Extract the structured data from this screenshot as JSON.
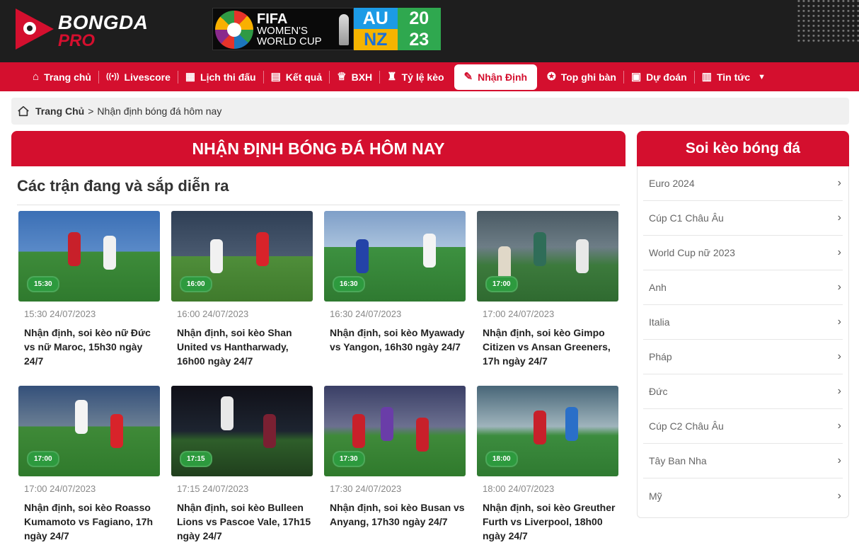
{
  "brand": {
    "name_top": "BONGDA",
    "name_bottom": "PRO"
  },
  "banner": {
    "line1": "FIFA",
    "line2": "WOMEN'S",
    "line3": "WORLD CUP",
    "grid": [
      "AU",
      "20",
      "NZ",
      "23"
    ]
  },
  "nav": {
    "items": [
      {
        "label": "Trang chủ",
        "icon": "home-icon"
      },
      {
        "label": "Livescore",
        "icon": "broadcast-icon"
      },
      {
        "label": "Lịch thi đấu",
        "icon": "calendar-icon"
      },
      {
        "label": "Kết quả",
        "icon": "scoreboard-icon"
      },
      {
        "label": "BXH",
        "icon": "trophy-icon"
      },
      {
        "label": "Tỷ lệ kèo",
        "icon": "odds-icon"
      },
      {
        "label": "Nhận Định",
        "icon": "analysis-icon"
      },
      {
        "label": "Top ghi bàn",
        "icon": "medal-icon"
      },
      {
        "label": "Dự đoán",
        "icon": "prediction-icon"
      },
      {
        "label": "Tin tức",
        "icon": "news-icon"
      }
    ],
    "active_index": 6
  },
  "breadcrumb": {
    "home": "Trang Chủ",
    "separator": ">",
    "current": "Nhận định bóng đá hôm nay"
  },
  "main": {
    "title": "NHẬN ĐỊNH BÓNG ĐÁ HÔM NAY",
    "section_heading": "Các trận đang và sắp diễn ra",
    "cards": [
      {
        "time": "15:30",
        "datetime": "15:30 24/07/2023",
        "title": "Nhận định, soi kèo nữ Đức vs nữ Maroc, 15h30 ngày 24/7"
      },
      {
        "time": "16:00",
        "datetime": "16:00 24/07/2023",
        "title": "Nhận định, soi kèo Shan United vs Hantharwady, 16h00 ngày 24/7"
      },
      {
        "time": "16:30",
        "datetime": "16:30 24/07/2023",
        "title": "Nhận định, soi kèo Myawady vs Yangon, 16h30 ngày 24/7"
      },
      {
        "time": "17:00",
        "datetime": "17:00 24/07/2023",
        "title": "Nhận định, soi kèo Gimpo Citizen vs Ansan Greeners, 17h ngày 24/7"
      },
      {
        "time": "17:00",
        "datetime": "17:00 24/07/2023",
        "title": "Nhận định, soi kèo Roasso Kumamoto vs Fagiano, 17h ngày 24/7"
      },
      {
        "time": "17:15",
        "datetime": "17:15 24/07/2023",
        "title": "Nhận định, soi kèo Bulleen Lions vs Pascoe Vale, 17h15 ngày 24/7"
      },
      {
        "time": "17:30",
        "datetime": "17:30 24/07/2023",
        "title": "Nhận định, soi kèo Busan vs Anyang, 17h30 ngày 24/7"
      },
      {
        "time": "18:00",
        "datetime": "18:00 24/07/2023",
        "title": "Nhận định, soi kèo Greuther Furth vs Liverpool, 18h00 ngày 24/7"
      }
    ]
  },
  "sidebar": {
    "title": "Soi kèo bóng đá",
    "items": [
      "Euro 2024",
      "Cúp C1 Châu Âu",
      "World Cup nữ 2023",
      "Anh",
      "Italia",
      "Pháp",
      "Đức",
      "Cúp C2 Châu Âu",
      "Tây Ban Nha",
      "Mỹ"
    ]
  },
  "colors": {
    "brand_red": "#d40f2e",
    "header_dark": "#1e1e1e",
    "badge_green": "#2d9a3e"
  }
}
